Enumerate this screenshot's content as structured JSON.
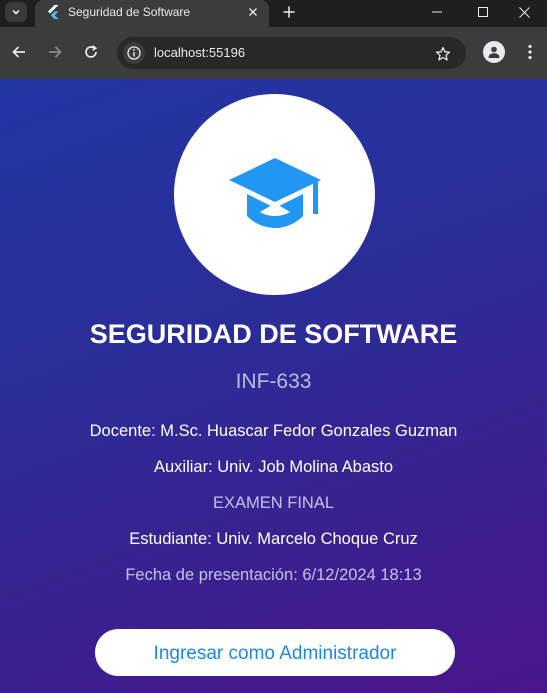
{
  "browser": {
    "tab": {
      "title": "Seguridad de Software",
      "favicon": "flutter-icon"
    },
    "address_bar": {
      "url": "localhost:55196"
    },
    "icons": {
      "tab_search": "chevron-down-icon",
      "tab_close": "close-icon",
      "new_tab": "plus-icon",
      "minimize": "minimize-icon",
      "maximize": "maximize-icon",
      "close_window": "close-icon",
      "back": "arrow-left-icon",
      "forward": "arrow-right-icon",
      "reload": "reload-icon",
      "site_info": "info-icon",
      "bookmark": "star-icon",
      "profile": "person-icon",
      "menu": "more-vert-icon"
    }
  },
  "page": {
    "logo_icon": "graduation-cap-icon",
    "title": "SEGURIDAD DE SOFTWARE",
    "course_code": "INF-633",
    "docente": "Docente: M.Sc. Huascar Fedor Gonzales Guzman",
    "auxiliar": "Auxiliar: Univ. Job Molina Abasto",
    "exam": "EXAMEN FINAL",
    "estudiante": "Estudiante: Univ. Marcelo Choque Cruz",
    "fecha": "Fecha de presentación: 6/12/2024 18:13",
    "login_button": "Ingresar como Administrador"
  },
  "colors": {
    "accent": "#1e88e5",
    "logo_icon": "#2196f3",
    "gradient_start": "#2236a3",
    "gradient_end": "#4a158c"
  }
}
